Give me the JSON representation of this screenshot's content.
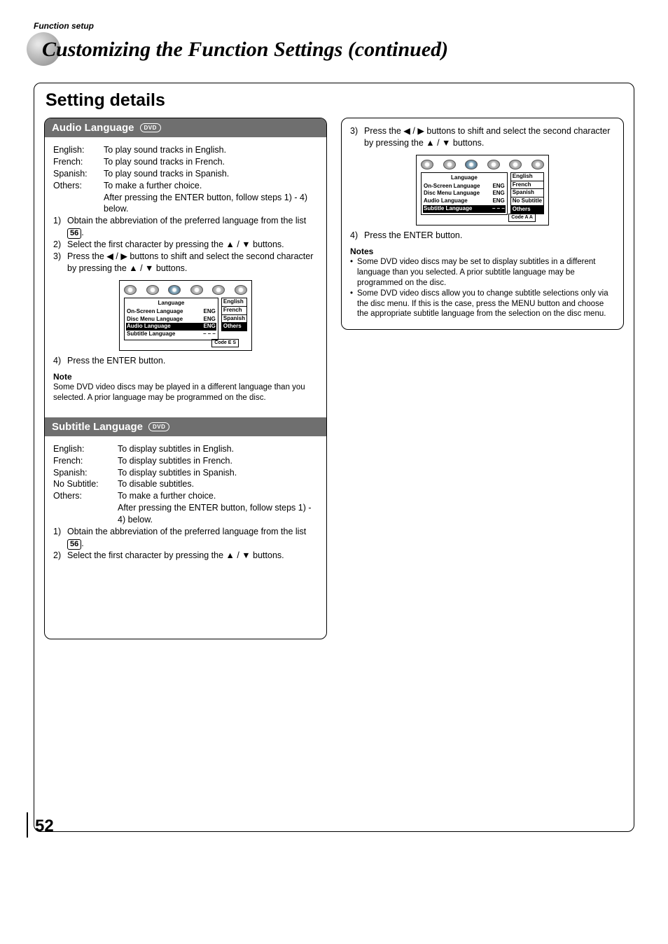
{
  "header": "Function setup",
  "title": "Customizing the Function Settings (continued)",
  "section_title": "Setting details",
  "dvd_label": "DVD",
  "page_ref": "56",
  "page_number": "52",
  "audio": {
    "heading": "Audio Language",
    "opts": [
      {
        "label": "English:",
        "desc": "To play sound tracks in English."
      },
      {
        "label": "French:",
        "desc": "To play sound tracks in French."
      },
      {
        "label": "Spanish:",
        "desc": "To play sound tracks in Spanish."
      },
      {
        "label": "Others:",
        "desc": "To make a further choice."
      }
    ],
    "others_follow": "After pressing the ENTER button, follow steps 1) - 4) below.",
    "steps": {
      "s1": "Obtain the abbreviation of the preferred language from the list ",
      "s1b": ".",
      "s2a": "Select the first character by pressing the ",
      "s2b": " / ",
      "s2c": " buttons.",
      "s3a": "Press the ",
      "s3b": " / ",
      "s3c": " buttons to shift and select the second character by pressing the ",
      "s3d": " / ",
      "s3e": " buttons.",
      "s4": "Press the ENTER button."
    },
    "diagram": {
      "title": "Language",
      "rows": [
        {
          "name": "On-Screen Language",
          "val": "ENG"
        },
        {
          "name": "Disc Menu Language",
          "val": "ENG"
        },
        {
          "name": "Audio Language",
          "val": "ENG",
          "hl": true
        },
        {
          "name": "Subtitle Language",
          "val": "– – –"
        }
      ],
      "right": [
        "English",
        "French",
        "Spanish",
        "Others"
      ],
      "right_hl_index": 3,
      "code": "Code  E  S"
    },
    "note_h": "Note",
    "note": "Some DVD video discs may be played in a different language than you selected. A prior language may be programmed on the disc."
  },
  "subtitle": {
    "heading": "Subtitle Language",
    "opts": [
      {
        "label": "English:",
        "desc": "To display subtitles in English."
      },
      {
        "label": "French:",
        "desc": "To display subtitles in French."
      },
      {
        "label": "Spanish:",
        "desc": "To display subtitles in Spanish."
      },
      {
        "label": "No Subtitle:",
        "desc": "To disable subtitles."
      },
      {
        "label": "Others:",
        "desc": "To make a further choice."
      }
    ],
    "others_follow": "After pressing the ENTER button, follow steps 1) - 4) below.",
    "step3a": "Press the ",
    "step3b": " / ",
    "step3c": " buttons to shift and select the second character by pressing the ",
    "step3d": " / ",
    "step3e": " buttons.",
    "step4": "Press the ENTER button.",
    "diagram": {
      "title": "Language",
      "rows": [
        {
          "name": "On-Screen Language",
          "val": "ENG"
        },
        {
          "name": "Disc Menu Language",
          "val": "ENG"
        },
        {
          "name": "Audio Language",
          "val": "ENG"
        },
        {
          "name": "Subtitle Language",
          "val": "– – –",
          "hl": true
        }
      ],
      "right": [
        "English",
        "French",
        "Spanish",
        "No Subtitle",
        "Others"
      ],
      "right_hl_index": 4,
      "code": "Code  A  A"
    },
    "notes_h": "Notes",
    "notes": [
      "Some DVD video discs may be set to display subtitles in a different language than you selected. A prior subtitle language may be programmed on the disc.",
      "Some DVD video discs allow you to change subtitle selections only via the disc menu.  If this is the case, press the MENU button and choose the appropriate subtitle language from the selection on the disc menu."
    ]
  },
  "arrows": {
    "left": "◀",
    "right": "▶",
    "up": "▲",
    "down": "▼"
  },
  "step_labels": {
    "s1": "1)",
    "s2": "2)",
    "s3": "3)",
    "s4": "4)"
  }
}
